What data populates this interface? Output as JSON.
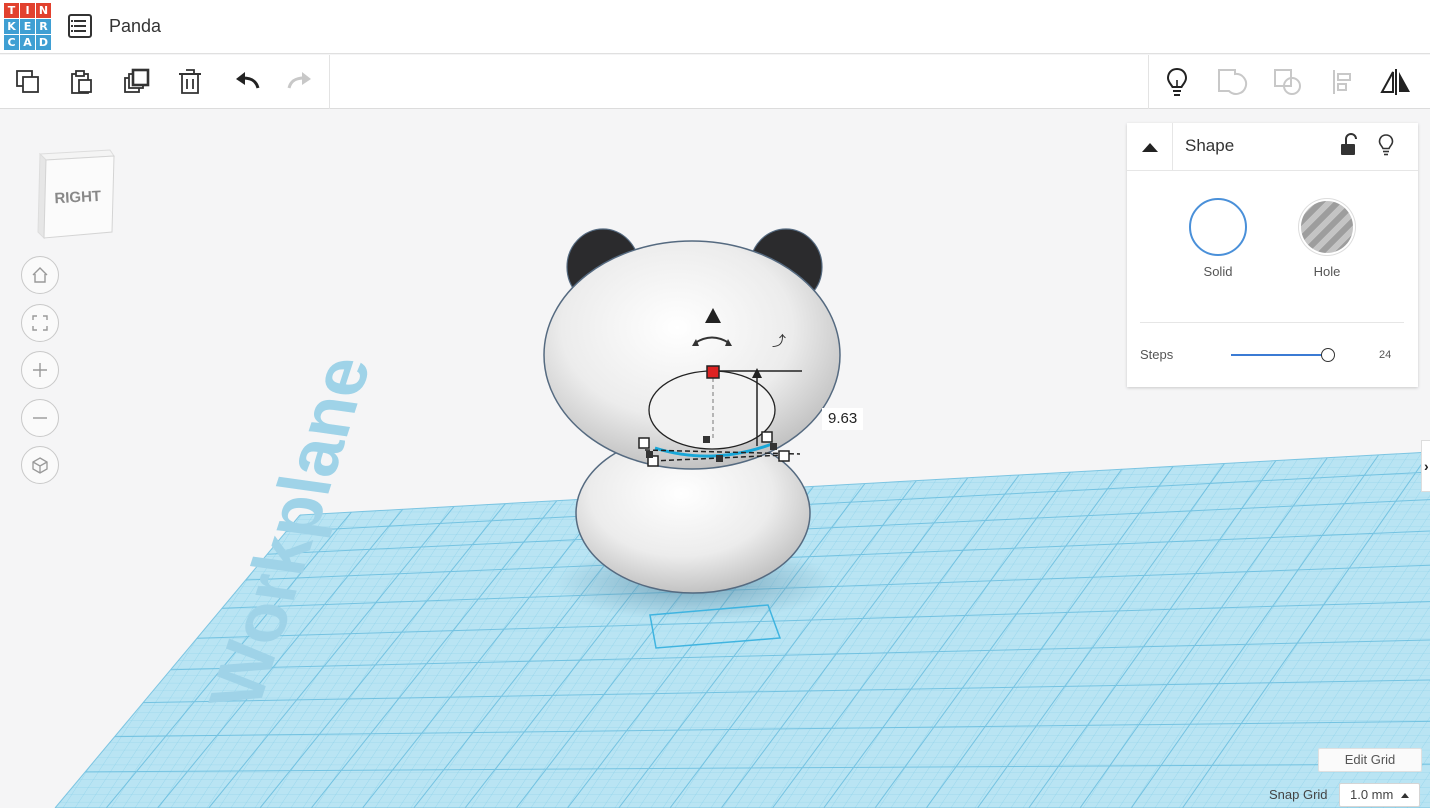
{
  "app": {
    "logo_letters": [
      "T",
      "I",
      "N",
      "K",
      "E",
      "R",
      "C",
      "A",
      "D"
    ],
    "logo_colors": [
      "#e2412e",
      "#e2412e",
      "#e2412e",
      "#3f9fd3",
      "#3f9fd3",
      "#3f9fd3",
      "#3f9fd3",
      "#3f9fd3",
      "#3f9fd3"
    ],
    "design_title": "Panda"
  },
  "toolbar": {
    "left_tools": [
      "copy-icon",
      "paste-icon",
      "duplicate-icon",
      "delete-icon",
      "undo-icon",
      "redo-icon"
    ],
    "right_tools": [
      "lightbulb-icon",
      "group-icon",
      "ungroup-icon",
      "align-icon",
      "mirror-icon"
    ]
  },
  "view_cube": {
    "face_label": "RIGHT"
  },
  "nav_controls": [
    "home-view-icon",
    "fit-view-icon",
    "zoom-in-icon",
    "zoom-out-icon",
    "perspective-icon"
  ],
  "workplane": {
    "label": "Workplane",
    "color": "#aee0f0"
  },
  "dimension": {
    "value": "9.63"
  },
  "shape_panel": {
    "title": "Shape",
    "solid_label": "Solid",
    "hole_label": "Hole",
    "steps_label": "Steps",
    "steps_value": "24",
    "solid_color": "#4a90d9"
  },
  "grid_controls": {
    "edit_grid_label": "Edit Grid",
    "snap_grid_label": "Snap Grid",
    "snap_grid_value": "1.0 mm"
  }
}
